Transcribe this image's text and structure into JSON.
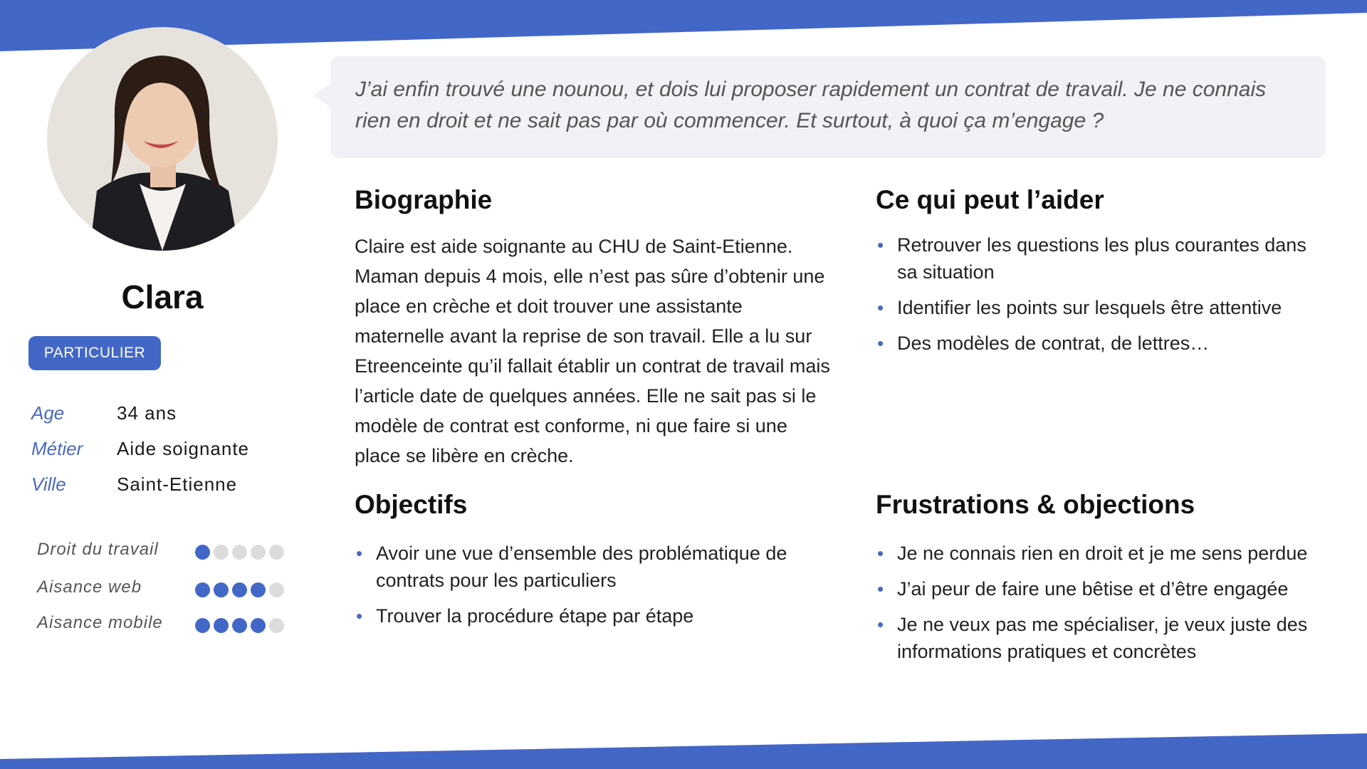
{
  "colors": {
    "accent": "#4267c7",
    "quote_bg": "#f0f2f6",
    "dot_off": "#dcdcdc"
  },
  "profile": {
    "name": "Clara",
    "badge": "PARTICULIER",
    "photo_icon": "avatar-photo",
    "info": [
      {
        "key": "Age",
        "value": "34 ans"
      },
      {
        "key": "Métier",
        "value": "Aide soignante"
      },
      {
        "key": "Ville",
        "value": "Saint-Etienne"
      }
    ],
    "skills": [
      {
        "label": "Droit du travail",
        "level": 1,
        "max": 5
      },
      {
        "label": "Aisance web",
        "level": 4,
        "max": 5
      },
      {
        "label": "Aisance mobile",
        "level": 4,
        "max": 5
      }
    ]
  },
  "quote": "J’ai enfin trouvé une nounou, et dois lui proposer rapidement un contrat de travail. Je ne connais rien en droit et ne sait pas par où commencer. Et surtout, à quoi ça m’engage ?",
  "biography": {
    "title": "Biographie",
    "text": "Claire est aide soignante au CHU de Saint-Etienne. Maman depuis 4 mois, elle n’est pas sûre d’obtenir une place en crèche et doit trouver une assistante maternelle avant la reprise de son travail. Elle a lu sur Etreenceinte qu’il fallait établir un contrat de travail mais l’article date de quelques années. Elle ne sait pas si le modèle de contrat est conforme, ni que faire si une place se libère en crèche."
  },
  "help": {
    "title": "Ce qui peut l’aider",
    "items": [
      "Retrouver les questions les plus courantes dans sa situation",
      "Identifier les points sur lesquels être attentive",
      "Des modèles de contrat, de lettres…"
    ]
  },
  "objectives": {
    "title": "Objectifs",
    "items": [
      "Avoir une vue d’ensemble des problématique de contrats pour les particuliers",
      "Trouver la procédure étape par étape"
    ]
  },
  "frustrations": {
    "title": "Frustrations & objections",
    "items": [
      "Je ne connais rien en droit et je me sens perdue",
      "J’ai peur de faire une bêtise et d’être engagée",
      "Je ne veux pas me spécialiser, je veux juste des informations pratiques et concrètes"
    ]
  }
}
